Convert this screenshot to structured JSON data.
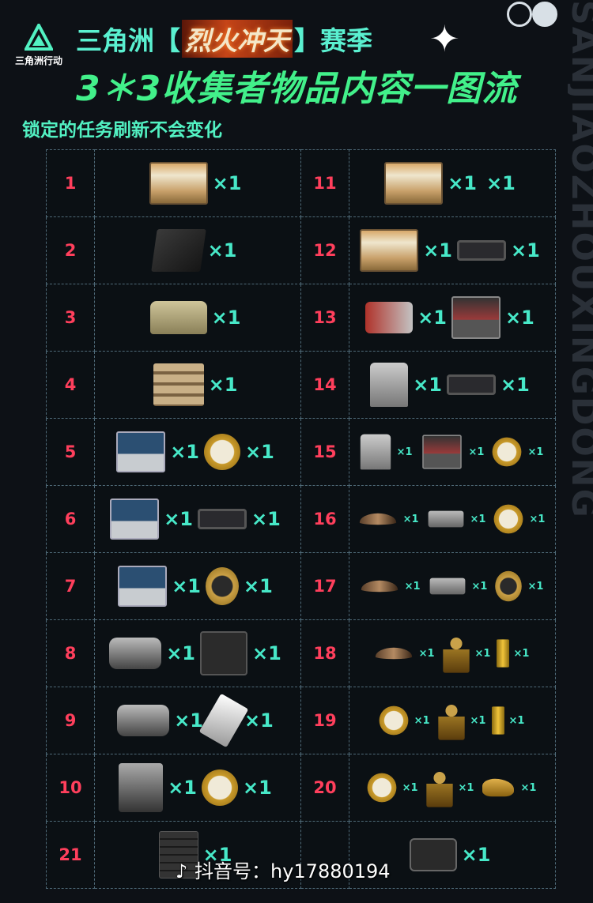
{
  "header": {
    "logo_text": "三角洲行动",
    "title_prefix": "三角洲【",
    "title_highlight": "烈火冲天",
    "title_suffix": "】赛季",
    "sparkle": "✦",
    "title_line2": "3＊3收集者物品内容一图流",
    "subtitle": "锁定的任务刷新不会变化",
    "background_text": "SANJIAOZHOUXINGDONG"
  },
  "watermark": {
    "platform": "抖音号：",
    "handle": "hy17880194"
  },
  "colors": {
    "accent": "#52f1c2",
    "title_green": "#42f08a",
    "number_red": "#ff3f5c",
    "multiplier": "#47e8c8"
  },
  "rows": [
    {
      "left": {
        "num": "1",
        "items": [
          {
            "icon": "battery-pack",
            "qty": "×1"
          }
        ]
      },
      "right": {
        "num": "11",
        "items": [
          {
            "icon": "battery-pack",
            "qty": "×1"
          },
          {
            "icon": "",
            "qty": "×1"
          }
        ]
      }
    },
    {
      "left": {
        "num": "2",
        "items": [
          {
            "icon": "carbon-plate",
            "qty": "×1"
          }
        ]
      },
      "right": {
        "num": "12",
        "items": [
          {
            "icon": "battery-pack",
            "qty": "×1"
          },
          {
            "icon": "graphics-card",
            "qty": "×1"
          }
        ]
      }
    },
    {
      "left": {
        "num": "3",
        "items": [
          {
            "icon": "tank-model",
            "qty": "×1"
          }
        ]
      },
      "right": {
        "num": "13",
        "items": [
          {
            "icon": "medical-device",
            "qty": "×1"
          },
          {
            "icon": "terminal",
            "qty": "×1"
          }
        ]
      }
    },
    {
      "left": {
        "num": "4",
        "items": [
          {
            "icon": "ammo-rack",
            "qty": "×1"
          }
        ]
      },
      "right": {
        "num": "14",
        "items": [
          {
            "icon": "robot-arm",
            "qty": "×1"
          },
          {
            "icon": "graphics-card",
            "qty": "×1"
          }
        ]
      }
    },
    {
      "left": {
        "num": "5",
        "items": [
          {
            "icon": "laptop",
            "qty": "×1"
          },
          {
            "icon": "pocket-watch",
            "qty": "×1"
          }
        ]
      },
      "right": {
        "num": "15",
        "small": true,
        "items": [
          {
            "icon": "robot-arm",
            "qty": "×1"
          },
          {
            "icon": "terminal",
            "qty": "×1"
          },
          {
            "icon": "pocket-watch",
            "qty": "×1"
          }
        ]
      }
    },
    {
      "left": {
        "num": "6",
        "items": [
          {
            "icon": "laptop",
            "qty": "×1"
          },
          {
            "icon": "graphics-card",
            "qty": "×1"
          }
        ]
      },
      "right": {
        "num": "16",
        "small": true,
        "items": [
          {
            "icon": "horn",
            "qty": "×1"
          },
          {
            "icon": "apc-model",
            "qty": "×1"
          },
          {
            "icon": "pocket-watch",
            "qty": "×1"
          }
        ]
      }
    },
    {
      "left": {
        "num": "7",
        "items": [
          {
            "icon": "laptop",
            "qty": "×1"
          },
          {
            "icon": "gold-wristwatch",
            "qty": "×1"
          }
        ]
      },
      "right": {
        "num": "17",
        "small": true,
        "items": [
          {
            "icon": "horn",
            "qty": "×1"
          },
          {
            "icon": "apc-model",
            "qty": "×1"
          },
          {
            "icon": "gold-wristwatch",
            "qty": "×1"
          }
        ]
      }
    },
    {
      "left": {
        "num": "8",
        "items": [
          {
            "icon": "cctv-camera",
            "qty": "×1"
          },
          {
            "icon": "tape-recorder",
            "qty": "×1"
          }
        ]
      },
      "right": {
        "num": "18",
        "small": true,
        "items": [
          {
            "icon": "horn",
            "qty": "×1"
          },
          {
            "icon": "bronze-bust",
            "qty": "×1"
          },
          {
            "icon": "gold-bar",
            "qty": "×1"
          }
        ]
      }
    },
    {
      "left": {
        "num": "9",
        "items": [
          {
            "icon": "cctv-camera",
            "qty": "×1"
          },
          {
            "icon": "usb-drive",
            "qty": "×1"
          }
        ]
      },
      "right": {
        "num": "19",
        "small": true,
        "items": [
          {
            "icon": "pocket-watch",
            "qty": "×1"
          },
          {
            "icon": "bronze-bust",
            "qty": "×1"
          },
          {
            "icon": "gold-bar",
            "qty": "×1"
          }
        ]
      }
    },
    {
      "left": {
        "num": "10",
        "items": [
          {
            "icon": "printer",
            "qty": "×1"
          },
          {
            "icon": "pocket-watch",
            "qty": "×1"
          }
        ]
      },
      "right": {
        "num": "20",
        "small": true,
        "items": [
          {
            "icon": "pocket-watch",
            "qty": "×1"
          },
          {
            "icon": "bronze-bust",
            "qty": "×1"
          },
          {
            "icon": "gold-hand",
            "qty": "×1"
          }
        ]
      }
    },
    {
      "left": {
        "num": "21",
        "items": [
          {
            "icon": "server-tower",
            "qty": "×1"
          }
        ]
      },
      "right": {
        "num": "",
        "items": [
          {
            "icon": "tablet",
            "qty": "×1"
          }
        ]
      }
    }
  ]
}
